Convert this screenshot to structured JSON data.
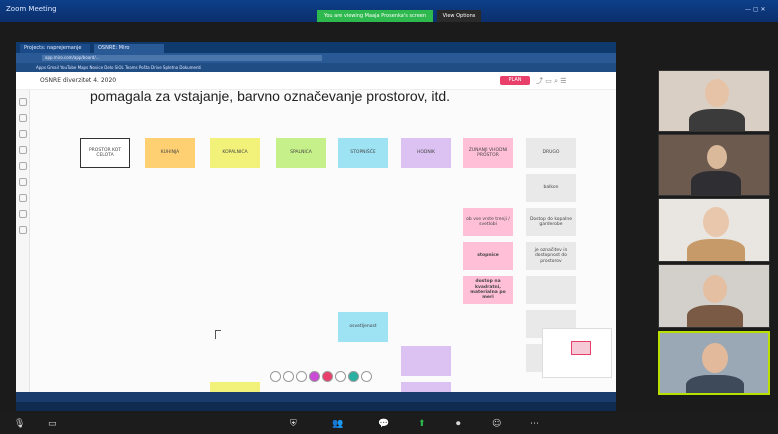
{
  "zoom": {
    "title": "Zoom Meeting",
    "share_banner": "You are viewing Maaja Prosenka's screen",
    "view_options": "View Options"
  },
  "browser": {
    "tab1": "Projects: naprejemanje",
    "tab2": "OSNRE: Miro",
    "url": "app.miro.com/app/board/...",
    "bookmarks": "Apps  Gmail  YouTube  Maps  Novice  Delo  SiOL  Teams  Pošta  Drive  Spletna  Dokumenti"
  },
  "miro": {
    "board_name": "OSNRE diverzitet 4. 2020",
    "plan_label": "PLAN",
    "heading": "pomagala za vstajanje, barvno označevanje prostorov, itd.",
    "notes": [
      {
        "text": "PROSTOR KOT CELOTA",
        "color": "#ffffff"
      },
      {
        "text": "KUHINJA",
        "color": "#ffd072"
      },
      {
        "text": "KOPALNICA",
        "color": "#f2f27a"
      },
      {
        "text": "SPALNICA",
        "color": "#c6f08a"
      },
      {
        "text": "STOPNIŠČE",
        "color": "#9ee3f4"
      },
      {
        "text": "HODNIK",
        "color": "#dcc2f2"
      },
      {
        "text": "ZUNANJI VHODNI PROSTOR",
        "color": "#ffbfd6"
      },
      {
        "text": "DRUGO",
        "color": "#e9e9e9"
      },
      {
        "text": "balkon",
        "color": "#e9e9e9"
      },
      {
        "text": "ob vse vrste trenji / svetlobi",
        "color": "#ffbfd6"
      },
      {
        "text": "Dostop do kopalne garderobe",
        "color": "#e9e9e9"
      },
      {
        "text": "stopnice",
        "color": "#ffbfd6"
      },
      {
        "text": "je označitev in dostopnost do prostorov",
        "color": "#e9e9e9"
      },
      {
        "text": "dostop na kvadratni, materialna po meri",
        "color": "#ffbfd6"
      },
      {
        "text": "osvetljenost",
        "color": "#9ee3f4"
      }
    ]
  },
  "participants": [
    "participant-1",
    "participant-2",
    "participant-3",
    "participant-4",
    "participant-5"
  ],
  "colors": {
    "zoom_blue": "#0b2f6b",
    "banner_green": "#2db94d",
    "miro_pink": "#e8406b"
  }
}
